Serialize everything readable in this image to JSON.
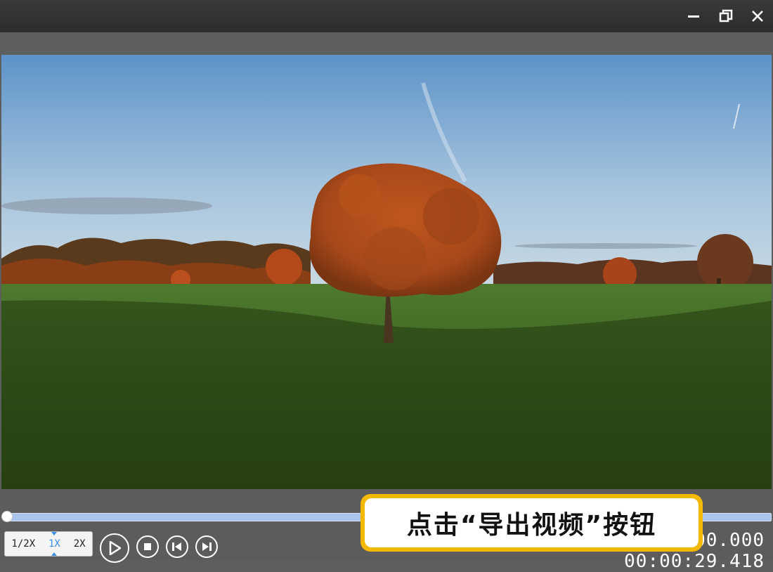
{
  "window": {
    "controls": [
      "minimize-icon",
      "restore-icon",
      "close-icon"
    ]
  },
  "player": {
    "progress": 0.0,
    "speed_options": [
      "1/2X",
      "1X",
      "2X"
    ],
    "selected_speed": "1X",
    "buttons": [
      "play-icon",
      "stop-icon",
      "previous-frame-icon",
      "next-frame-icon"
    ],
    "current_time": "00:00:00.000",
    "total_time": "00:00:29.418"
  },
  "callout": {
    "text": "点击“导出视频”按钮"
  },
  "colors": {
    "accent": "#3a8ee6",
    "callout_border": "#f5b800",
    "seek_bar": "#a9c3ea"
  }
}
